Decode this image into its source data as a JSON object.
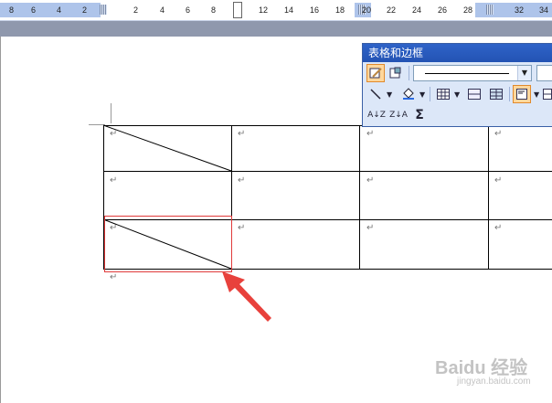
{
  "ruler": {
    "ticks": [
      "8",
      "6",
      "4",
      "2",
      "2",
      "4",
      "6",
      "8",
      "12",
      "14",
      "16",
      "18",
      "20",
      "22",
      "24",
      "26",
      "28",
      "32",
      "34"
    ]
  },
  "toolbar": {
    "title": "表格和边框",
    "sort_ascending_label": "A↓Z",
    "sort_descending_label": "Z↓A",
    "autosum_label": "Σ"
  },
  "table": {
    "paragraph_mark": "↵"
  },
  "annotation": {
    "highlight_color": "#e03a3a",
    "arrow_color": "#e8413c"
  },
  "watermark": {
    "text": "Baidu 经验",
    "subtext": "jingyan.baidu.com"
  }
}
